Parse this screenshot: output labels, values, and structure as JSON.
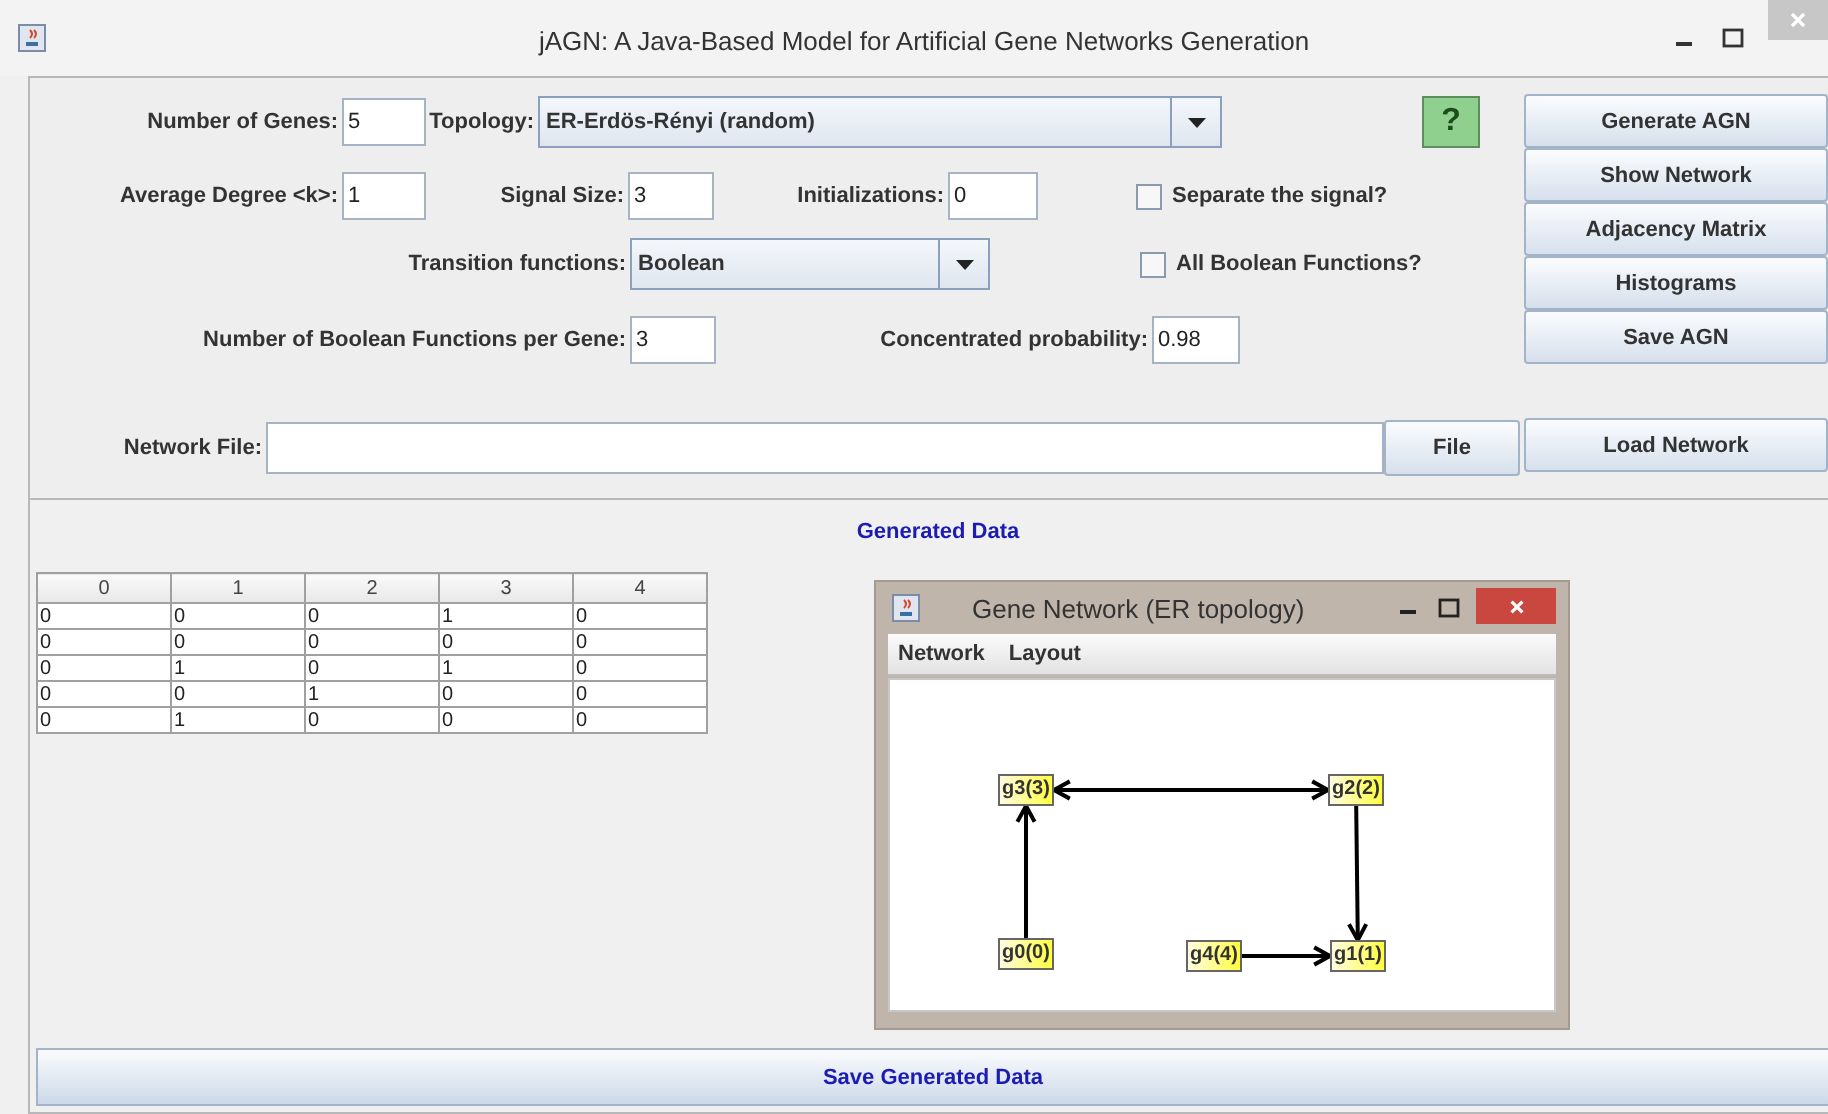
{
  "window": {
    "title": "jAGN: A Java-Based Model for Artificial Gene Networks Generation"
  },
  "form": {
    "genes": {
      "label": "Number of Genes:",
      "value": "5"
    },
    "topology": {
      "label": "Topology:",
      "value": "ER-Erdös-Rényi (random)"
    },
    "degree": {
      "label": "Average Degree <k>:",
      "value": "1"
    },
    "signal_size": {
      "label": "Signal Size:",
      "value": "3"
    },
    "initializations": {
      "label": "Initializations:",
      "value": "0"
    },
    "separate_signal": {
      "label": "Separate the signal?",
      "checked": false
    },
    "transition": {
      "label": "Transition functions:",
      "value": "Boolean"
    },
    "all_boolean": {
      "label": "All Boolean Functions?",
      "checked": false
    },
    "functions_per_gene": {
      "label": "Number of Boolean Functions per Gene:",
      "value": "3"
    },
    "concentrated": {
      "label": "Concentrated probability:",
      "value": "0.98"
    },
    "help_button": "?",
    "network_file": {
      "label": "Network File:"
    },
    "file_button": "File"
  },
  "side_buttons": [
    "Generate AGN",
    "Show Network",
    "Adjacency Matrix",
    "Histograms",
    "Save AGN"
  ],
  "load_button": "Load Network",
  "generated_data": {
    "title": "Generated Data",
    "columns": [
      "0",
      "1",
      "2",
      "3",
      "4"
    ],
    "rows": [
      [
        "0",
        "0",
        "0",
        "1",
        "0"
      ],
      [
        "0",
        "0",
        "0",
        "0",
        "0"
      ],
      [
        "0",
        "1",
        "0",
        "1",
        "0"
      ],
      [
        "0",
        "0",
        "1",
        "0",
        "0"
      ],
      [
        "0",
        "1",
        "0",
        "0",
        "0"
      ]
    ]
  },
  "gene_window": {
    "title": "Gene Network (ER topology)",
    "menu": [
      "Network",
      "Layout"
    ],
    "nodes": [
      {
        "label": "g3(3)"
      },
      {
        "label": "g2(2)"
      },
      {
        "label": "g0(0)"
      },
      {
        "label": "g4(4)"
      },
      {
        "label": "g1(1)"
      }
    ]
  },
  "save_button": "Save Generated Data"
}
